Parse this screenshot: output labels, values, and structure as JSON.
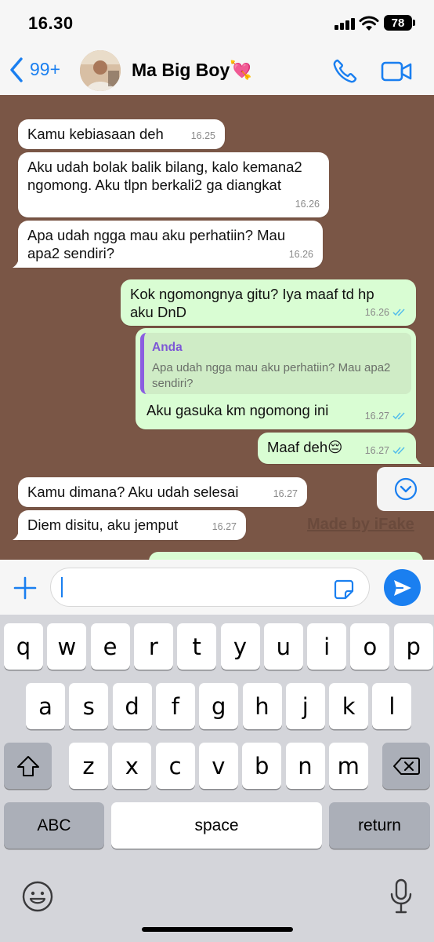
{
  "status_bar": {
    "time": "16.30",
    "battery": "78"
  },
  "header": {
    "back_count": "99+",
    "contact_name": "Ma Big Boy💘"
  },
  "messages": [
    {
      "dir": "in",
      "text": "Kamu kebiasaan deh",
      "time": "16.25"
    },
    {
      "dir": "in",
      "text": "Aku udah bolak balik bilang, kalo kemana2 ngomong. Aku tlpn berkali2 ga diangkat",
      "time": "16.26"
    },
    {
      "dir": "in",
      "text": "Apa udah ngga mau aku perhatiin? Mau apa2 sendiri?",
      "time": "16.26"
    },
    {
      "dir": "out",
      "text": "Kok ngomongnya gitu? Iya maaf td hp aku DnD",
      "time": "16.26",
      "status": "read"
    },
    {
      "dir": "out",
      "reply_to": {
        "author": "Anda",
        "text": "Apa udah ngga mau aku perhatiin? Mau apa2 sendiri?"
      },
      "text": "Aku gasuka km ngomong ini",
      "time": "16.27",
      "status": "read"
    },
    {
      "dir": "out",
      "text": "Maaf deh😔",
      "time": "16.27",
      "status": "read"
    },
    {
      "dir": "in",
      "text": "Kamu dimana? Aku udah selesai",
      "time": "16.27"
    },
    {
      "dir": "in",
      "text": "Diem disitu, aku jemput",
      "time": "16.27"
    }
  ],
  "watermark": "Made by iFake",
  "input": {
    "value": ""
  },
  "keyboard": {
    "row1": [
      "q",
      "w",
      "e",
      "r",
      "t",
      "y",
      "u",
      "i",
      "o",
      "p"
    ],
    "row2": [
      "a",
      "s",
      "d",
      "f",
      "g",
      "h",
      "j",
      "k",
      "l"
    ],
    "row3": [
      "z",
      "x",
      "c",
      "v",
      "b",
      "n",
      "m"
    ],
    "abc_label": "ABC",
    "space_label": "space",
    "return_label": "return"
  },
  "colors": {
    "accent": "#1a7ff0",
    "chat_background": "#7a5646",
    "incoming_bubble": "#ffffff",
    "outgoing_bubble": "#d9fdd3",
    "read_ticks": "#53bdeb",
    "reply_author": "#7d57d6"
  },
  "icons": {
    "back": "chevron-left-icon",
    "call": "phone-icon",
    "video": "video-camera-icon",
    "scroll": "chevron-down-circle-icon",
    "attach": "plus-icon",
    "sticker": "sticker-icon",
    "send": "send-arrow-icon",
    "shift": "shift-arrow-icon",
    "delete": "backspace-icon",
    "emoji": "emoji-icon",
    "mic": "microphone-icon"
  }
}
